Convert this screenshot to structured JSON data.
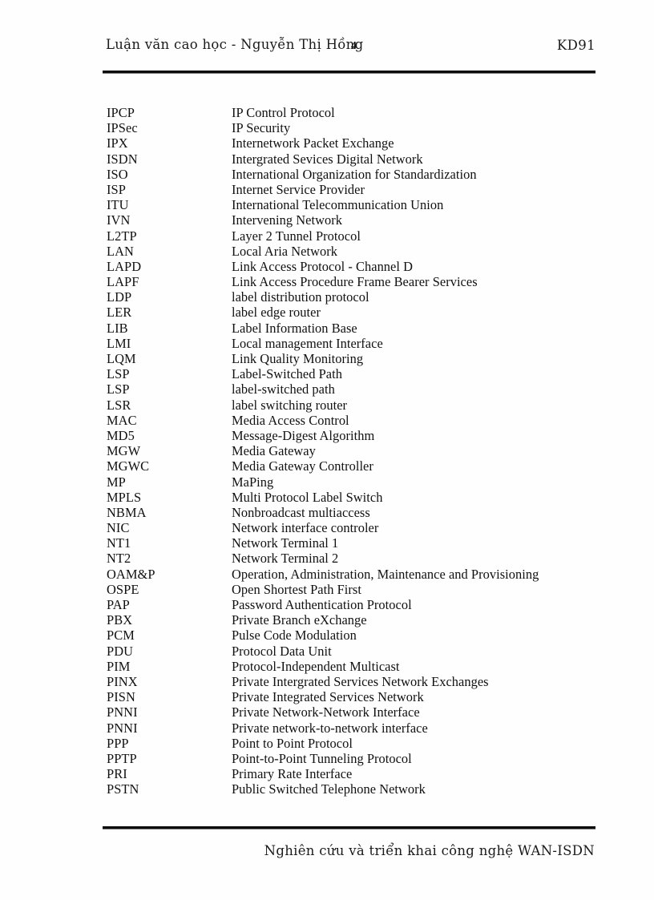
{
  "header": {
    "left_text": "Luận văn cao học - Nguyễn Thị Hồng",
    "page_number": "4",
    "right_text": "KD91"
  },
  "footer": {
    "note": "Nghiên cứu và triển khai công nghệ WAN-ISDN"
  },
  "glossary": {
    "entries": [
      {
        "abbr": "IPCP",
        "definition": "IP Control Protocol"
      },
      {
        "abbr": "IPSec",
        "definition": "IP Security"
      },
      {
        "abbr": "IPX",
        "definition": "Internetwork Packet Exchange"
      },
      {
        "abbr": "ISDN",
        "definition": "Intergrated Sevices Digital Network"
      },
      {
        "abbr": "ISO",
        "definition": "International Organization for Standardization"
      },
      {
        "abbr": "ISP",
        "definition": "Internet Service Provider"
      },
      {
        "abbr": "ITU",
        "definition": "International Telecommunication Union"
      },
      {
        "abbr": "IVN",
        "definition": "Intervening Network"
      },
      {
        "abbr": "L2TP",
        "definition": "Layer 2 Tunnel Protocol"
      },
      {
        "abbr": "LAN",
        "definition": "Local Aria Network"
      },
      {
        "abbr": "LAPD",
        "definition": "Link Access Protocol - Channel D"
      },
      {
        "abbr": "LAPF",
        "definition": "Link Access Procedure Frame Bearer Services"
      },
      {
        "abbr": "LDP",
        "definition": "label distribution protocol"
      },
      {
        "abbr": "LER",
        "definition": "label edge router"
      },
      {
        "abbr": "LIB",
        "definition": "Label Information Base"
      },
      {
        "abbr": "LMI",
        "definition": "Local management Interface"
      },
      {
        "abbr": "LQM",
        "definition": "Link Quality Monitoring"
      },
      {
        "abbr": "LSP",
        "definition": "Label-Switched Path"
      },
      {
        "abbr": "LSP",
        "definition": "label-switched path"
      },
      {
        "abbr": "LSR",
        "definition": "label switching router"
      },
      {
        "abbr": "MAC",
        "definition": "Media Access Control"
      },
      {
        "abbr": "MD5",
        "definition": "Message-Digest Algorithm"
      },
      {
        "abbr": "MGW",
        "definition": "Media Gateway"
      },
      {
        "abbr": "MGWC",
        "definition": "Media Gateway Controller"
      },
      {
        "abbr": "MP",
        "definition": "MaPing"
      },
      {
        "abbr": "MPLS",
        "definition": "Multi Protocol Label Switch"
      },
      {
        "abbr": "NBMA",
        "definition": "Nonbroadcast multiaccess"
      },
      {
        "abbr": "NIC",
        "definition": "Network interface controler"
      },
      {
        "abbr": "NT1",
        "definition": "Network Terminal 1"
      },
      {
        "abbr": "NT2",
        "definition": "Network Terminal 2"
      },
      {
        "abbr": "OAM&P",
        "definition": "Operation, Administration, Maintenance and Provisioning"
      },
      {
        "abbr": "OSPE",
        "definition": "Open Shortest Path First"
      },
      {
        "abbr": "PAP",
        "definition": "Password Authentication Protocol"
      },
      {
        "abbr": "PBX",
        "definition": "Private Branch eXchange"
      },
      {
        "abbr": "PCM",
        "definition": "Pulse Code Modulation"
      },
      {
        "abbr": "PDU",
        "definition": "Protocol Data Unit"
      },
      {
        "abbr": "PIM",
        "definition": "Protocol-Independent Multicast"
      },
      {
        "abbr": "PINX",
        "definition": "Private Intergrated Services Network Exchanges"
      },
      {
        "abbr": "PISN",
        "definition": "Private Integrated Services Network"
      },
      {
        "abbr": "PNNI",
        "definition": "Private Network-Network Interface"
      },
      {
        "abbr": "PNNI",
        "definition": "Private network-to-network interface"
      },
      {
        "abbr": "PPP",
        "definition": "Point to Point Protocol"
      },
      {
        "abbr": "PPTP",
        "definition": "Point-to-Point Tunneling Protocol"
      },
      {
        "abbr": "PRI",
        "definition": "Primary Rate Interface"
      },
      {
        "abbr": "PSTN",
        "definition": "Public Switched Telephone Network"
      }
    ]
  }
}
